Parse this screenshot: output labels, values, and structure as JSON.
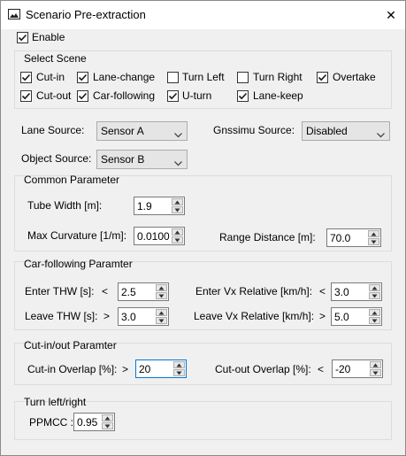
{
  "window": {
    "title": "Scenario Pre-extraction",
    "close_glyph": "✕",
    "icon": "image-icon"
  },
  "enable": {
    "label": "Enable",
    "checked": true
  },
  "select_scene": {
    "title": "Select Scene",
    "items": [
      {
        "label": "Cut-in",
        "checked": true
      },
      {
        "label": "Lane-change",
        "checked": true
      },
      {
        "label": "Turn Left",
        "checked": false
      },
      {
        "label": "Turn Right",
        "checked": false
      },
      {
        "label": "Overtake",
        "checked": true
      },
      {
        "label": "Cut-out",
        "checked": true
      },
      {
        "label": "Car-following",
        "checked": true
      },
      {
        "label": "U-turn",
        "checked": true
      },
      {
        "label": "Lane-keep",
        "checked": true
      }
    ]
  },
  "sources": {
    "lane_label": "Lane Source:",
    "lane_value": "Sensor A",
    "gnss_label": "Gnssimu Source:",
    "gnss_value": "Disabled",
    "object_label": "Object Source:",
    "object_value": "Sensor B"
  },
  "common": {
    "title": "Common Parameter",
    "tube_label": "Tube Width [m]:",
    "tube_value": "1.9",
    "curv_label": "Max Curvature [1/m]:",
    "curv_value": "0.0100",
    "range_label": "Range Distance [m]:",
    "range_value": "70.0"
  },
  "car_following": {
    "title": "Car-following Paramter",
    "enter_thw_label": "Enter THW [s]:",
    "enter_thw_op": "<",
    "enter_thw_value": "2.5",
    "leave_thw_label": "Leave THW [s]:",
    "leave_thw_op": ">",
    "leave_thw_value": "3.0",
    "enter_vx_label": "Enter Vx Relative [km/h]:",
    "enter_vx_op": "<",
    "enter_vx_value": "3.0",
    "leave_vx_label": "Leave Vx Relative [km/h]:",
    "leave_vx_op": ">",
    "leave_vx_value": "5.0"
  },
  "cut_in_out": {
    "title": "Cut-in/out Paramter",
    "cutin_label": "Cut-in Overlap [%]:",
    "cutin_op": ">",
    "cutin_value": "20",
    "cutout_label": "Cut-out Overlap [%]:",
    "cutout_op": "<",
    "cutout_value": "-20"
  },
  "turn": {
    "title": "Turn left/right",
    "ppmcc_label": "PPMCC :",
    "ppmcc_value": "0.95"
  },
  "colors": {
    "accent": "#0078d7",
    "check": "#1a1a1a",
    "group_border": "#dcdcdc"
  }
}
